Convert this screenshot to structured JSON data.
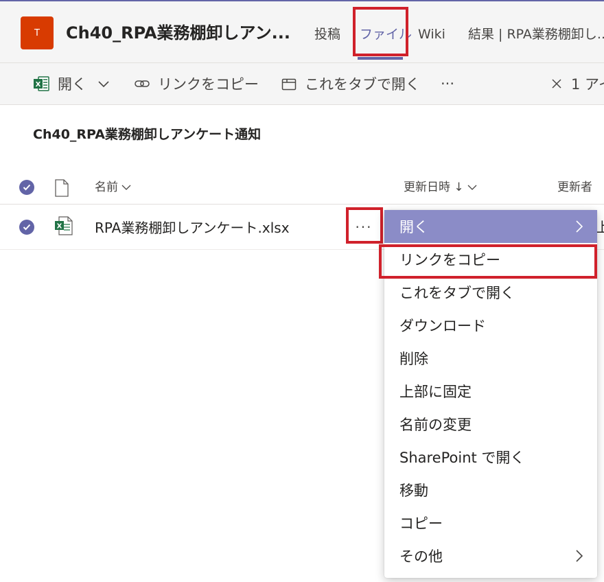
{
  "header": {
    "team_avatar_letter": "T",
    "channel_title": "Ch40_RPA業務棚卸しアン...",
    "tabs": [
      {
        "label": "投稿"
      },
      {
        "label": "ファイル"
      },
      {
        "label": "Wiki"
      },
      {
        "label": "結果 | RPA業務棚卸し..."
      }
    ],
    "active_tab_color": "#6264a7",
    "highlight_color": "#d0212b"
  },
  "toolbar": {
    "open_label": "開く",
    "copy_link_label": "リンクをコピー",
    "open_in_tab_label": "これをタブで開く",
    "more_label": "···",
    "selection_label": "1 アイ"
  },
  "folder": {
    "title": "Ch40_RPA業務棚卸しアンケート通知"
  },
  "list": {
    "columns": {
      "name": "名前",
      "modified": "更新日時 ↓",
      "modified_by": "更新者"
    },
    "rows": [
      {
        "name": "RPA業務棚卸しアンケート.xlsx",
        "modified_by_partial": "上"
      }
    ]
  },
  "context_menu": {
    "items": [
      {
        "label": "開く",
        "has_submenu": true
      },
      {
        "label": "リンクをコピー"
      },
      {
        "label": "これをタブで開く"
      },
      {
        "label": "ダウンロード"
      },
      {
        "label": "削除"
      },
      {
        "label": "上部に固定"
      },
      {
        "label": "名前の変更"
      },
      {
        "label": "SharePoint で開く"
      },
      {
        "label": "移動"
      },
      {
        "label": "コピー"
      },
      {
        "label": "その他",
        "has_submenu": true
      }
    ],
    "selected_color": "#8b8cc7"
  },
  "icons": {
    "excel": "excel-icon",
    "link": "link-icon",
    "tab": "tab-icon",
    "close": "close-icon",
    "check": "check-icon",
    "file": "file-icon",
    "chevron_down": "chevron-down-icon",
    "chevron_right": "chevron-right-icon"
  }
}
